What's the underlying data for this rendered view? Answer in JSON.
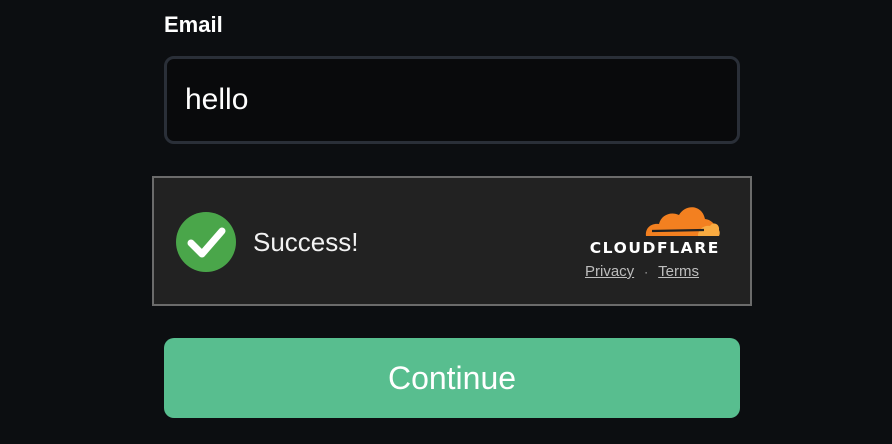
{
  "form": {
    "email_label": "Email",
    "email_value": "hello",
    "continue_label": "Continue"
  },
  "turnstile": {
    "status_text": "Success!",
    "status_icon": "check-icon",
    "brand": "CLOUDFLARE",
    "privacy_label": "Privacy",
    "separator": "·",
    "terms_label": "Terms"
  },
  "colors": {
    "background": "#0c0e11",
    "success_green": "#4aa64a",
    "button_green": "#58be8f",
    "cloudflare_orange": "#f38020"
  }
}
